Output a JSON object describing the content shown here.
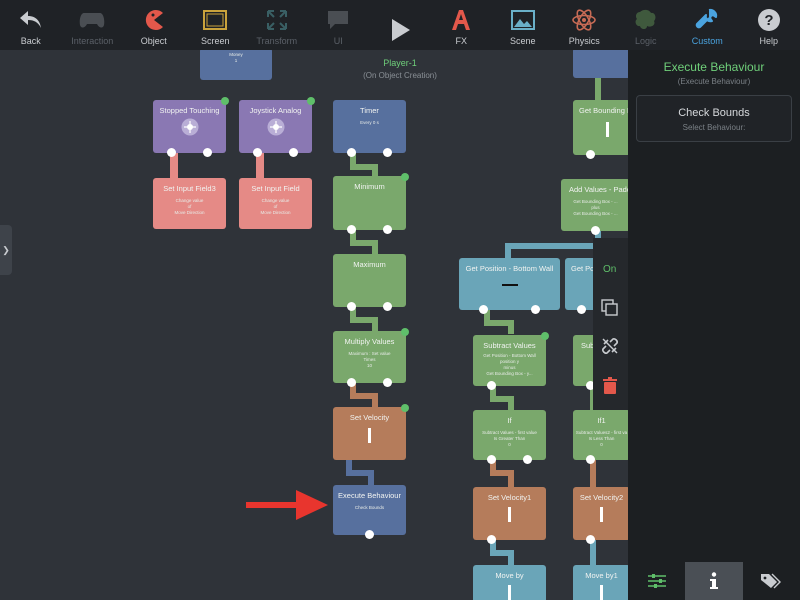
{
  "toolbar": {
    "items": [
      {
        "label": "Back",
        "icon": "back-arrow-icon",
        "state": "normal"
      },
      {
        "label": "Interaction",
        "icon": "gamepad-icon",
        "state": "dim"
      },
      {
        "label": "Object",
        "icon": "pacman-icon",
        "state": "normal"
      },
      {
        "label": "Screen",
        "icon": "screen-frame-icon",
        "state": "normal"
      },
      {
        "label": "Transform",
        "icon": "expand-arrows-icon",
        "state": "dim"
      },
      {
        "label": "UI",
        "icon": "speech-bubble-icon",
        "state": "dim"
      },
      {
        "label": "",
        "icon": "play-icon",
        "state": "normal"
      },
      {
        "label": "FX",
        "icon": "fx-letter-icon",
        "state": "normal"
      },
      {
        "label": "Scene",
        "icon": "landscape-image-icon",
        "state": "normal"
      },
      {
        "label": "Physics",
        "icon": "atom-icon",
        "state": "normal"
      },
      {
        "label": "Logic",
        "icon": "brain-icon",
        "state": "dim"
      },
      {
        "label": "Custom",
        "icon": "wrench-icon",
        "state": "active"
      },
      {
        "label": "Help",
        "icon": "question-icon",
        "state": "normal"
      }
    ]
  },
  "canvas": {
    "title": "Player-1",
    "subtitle": "(On Object Creation)"
  },
  "nodes": {
    "top_stub": {
      "title": "",
      "sub": "Money\n1"
    },
    "stopped_touching": {
      "title": "Stopped Touching"
    },
    "joystick_analog": {
      "title": "Joystick Analog"
    },
    "set_input_field3": {
      "title": "Set Input Field3",
      "sub": "Change value\nof\nMove Direction"
    },
    "set_input_field": {
      "title": "Set Input Field",
      "sub": "Change value\nof\nMove Direction"
    },
    "timer": {
      "title": "Timer",
      "sub": "Every 0 s"
    },
    "minimum": {
      "title": "Minimum"
    },
    "maximum": {
      "title": "Maximum"
    },
    "multiply_values": {
      "title": "Multiply Values",
      "sub": "Maximum : Set value\nTimes\n10"
    },
    "set_velocity": {
      "title": "Set Velocity"
    },
    "execute_behaviour": {
      "title": "Execute Behaviour",
      "sub": "Check Bounds"
    },
    "get_bounding": {
      "title": "Get Bounding B"
    },
    "add_values": {
      "title": "Add Values - Padd",
      "sub": "Get Bounding Box - ...\nplus\nGet Bounding Box - ..."
    },
    "get_position_bottom": {
      "title": "Get Position - Bottom Wall"
    },
    "get_po": {
      "title": "Get Po"
    },
    "subtract_values": {
      "title": "Subtract Values",
      "sub": "Get Position - Bottom Wall\nposition y\nminus\nGet Bounding Box - y..."
    },
    "subt": {
      "title": "Subt"
    },
    "if_node": {
      "title": "If",
      "sub": "Subtract Values - first value\nIs Greater Than\n0"
    },
    "if1": {
      "title": "If1",
      "sub": "Subtract Values2 - first va\nIs Less Than\n0"
    },
    "set_velocity1": {
      "title": "Set Velocity1"
    },
    "set_velocity2": {
      "title": "Set Velocity2"
    },
    "move_by": {
      "title": "Move by"
    },
    "move_by1": {
      "title": "Move by1"
    }
  },
  "context_menu": {
    "on_label": "On"
  },
  "panel": {
    "title": "Execute Behaviour",
    "subtitle": "(Execute Behaviour)",
    "behaviour_name": "Check Bounds",
    "behaviour_hint": "Select Behaviour:"
  },
  "colors": {
    "accent_green": "#6fcf7a",
    "accent_blue": "#4aa3df",
    "node_purple": "#8a78b3",
    "node_pink": "#e58a86",
    "node_blue": "#57709e",
    "node_green": "#7aa86c",
    "node_brown": "#b57c5b",
    "node_teal": "#6aa5b8",
    "annotation_red": "#e8352e"
  }
}
